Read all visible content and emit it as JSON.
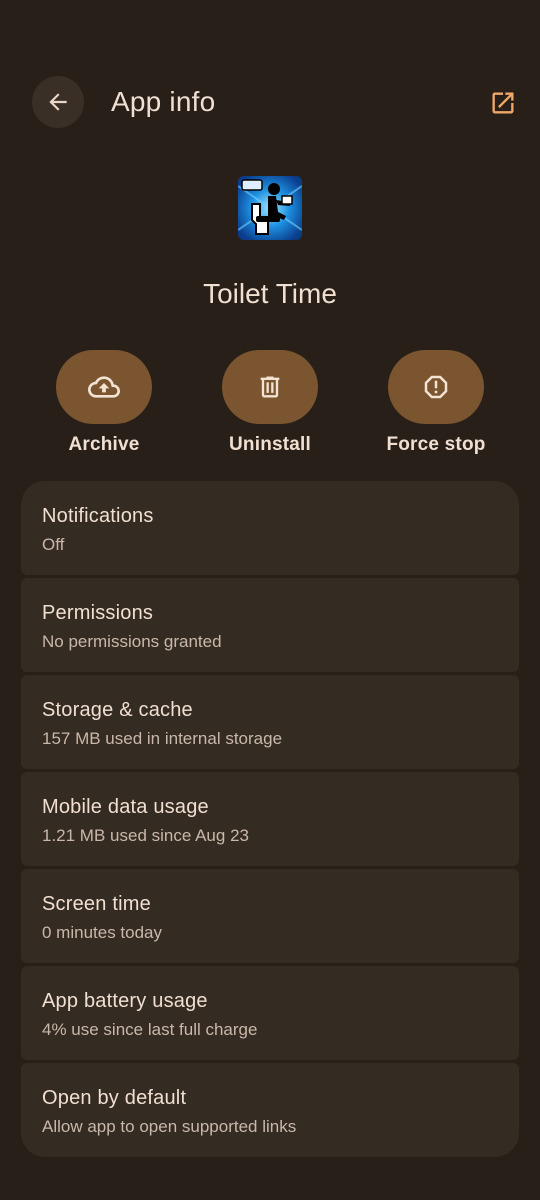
{
  "header": {
    "title": "App info",
    "back_icon": "arrow-back-icon",
    "open_icon": "open-in-new-icon"
  },
  "app": {
    "name": "Toilet Time",
    "icon": "toilet-time-app-icon"
  },
  "actions": [
    {
      "label": "Archive",
      "icon": "cloud-upload-icon"
    },
    {
      "label": "Uninstall",
      "icon": "trash-icon"
    },
    {
      "label": "Force stop",
      "icon": "alert-octagon-icon"
    }
  ],
  "settings": [
    {
      "title": "Notifications",
      "subtitle": "Off"
    },
    {
      "title": "Permissions",
      "subtitle": "No permissions granted"
    },
    {
      "title": "Storage & cache",
      "subtitle": "157 MB used in internal storage"
    },
    {
      "title": "Mobile data usage",
      "subtitle": "1.21 MB used since Aug 23"
    },
    {
      "title": "Screen time",
      "subtitle": "0 minutes today"
    },
    {
      "title": "App battery usage",
      "subtitle": "4% use since last full charge"
    },
    {
      "title": "Open by default",
      "subtitle": "Allow app to open supported links"
    }
  ],
  "colors": {
    "background": "#271f18",
    "card": "#342b22",
    "accent_pill": "#7a5530",
    "accent_icon": "#f0a868"
  }
}
